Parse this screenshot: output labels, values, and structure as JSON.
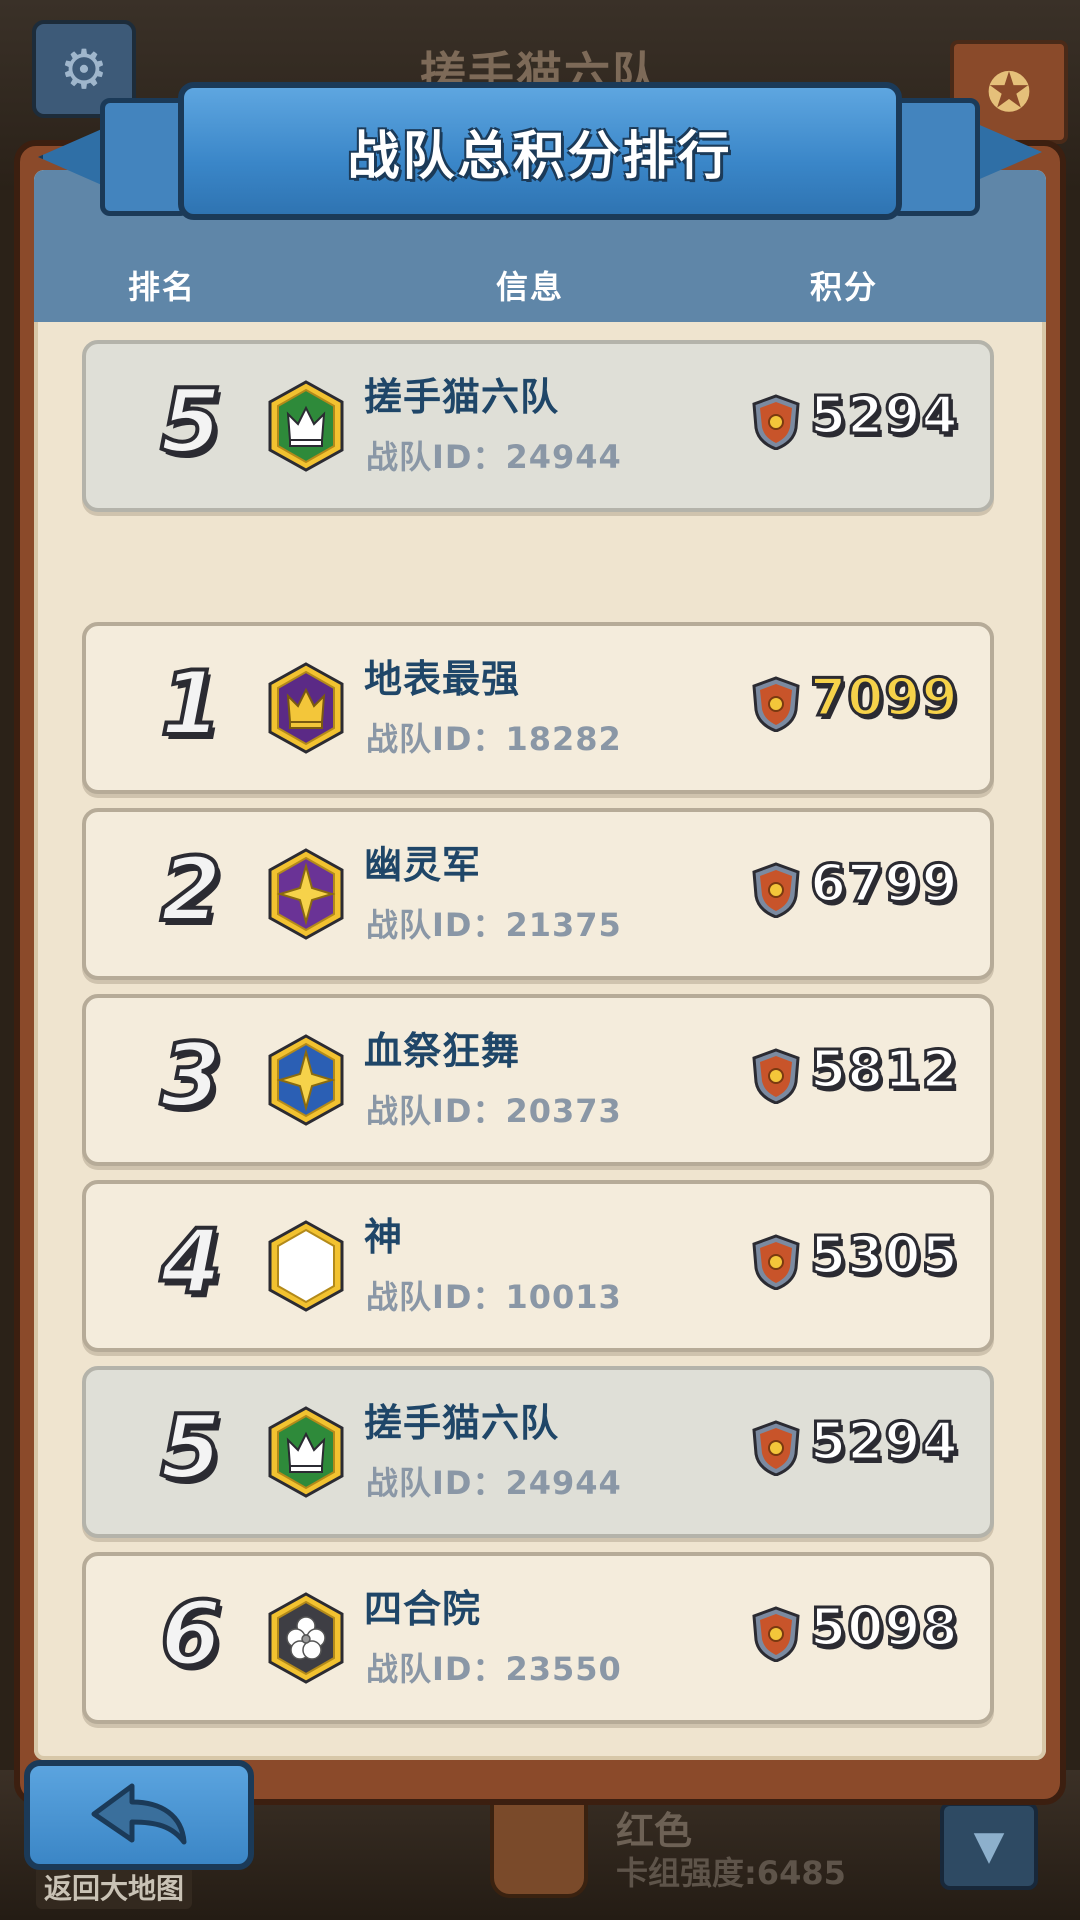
{
  "background": {
    "title": "搓手猫六队",
    "player_name": "红色",
    "deck_strength": "卡组强度:6485",
    "return_label": "返回大地图"
  },
  "panel": {
    "title": "战队总积分排行",
    "columns": {
      "rank": "排名",
      "info": "信息",
      "score": "积分"
    }
  },
  "my_team": {
    "rank": "5",
    "name": "搓手猫六队",
    "id": "战队ID：24944",
    "score": "5294",
    "emblem": "crown-green"
  },
  "rows": [
    {
      "rank": "1",
      "name": "地表最强",
      "id": "战队ID：18282",
      "score": "7099",
      "emblem": "crown-purple"
    },
    {
      "rank": "2",
      "name": "幽灵军",
      "id": "战队ID：21375",
      "score": "6799",
      "emblem": "star-purple"
    },
    {
      "rank": "3",
      "name": "血祭狂舞",
      "id": "战队ID：20373",
      "score": "5812",
      "emblem": "star-blue"
    },
    {
      "rank": "4",
      "name": "神",
      "id": "战队ID：10013",
      "score": "5305",
      "emblem": "blank-white"
    },
    {
      "rank": "5",
      "name": "搓手猫六队",
      "id": "战队ID：24944",
      "score": "5294",
      "emblem": "crown-green"
    },
    {
      "rank": "6",
      "name": "四合院",
      "id": "战队ID：23550",
      "score": "5098",
      "emblem": "flower-gray"
    }
  ],
  "colors": {
    "ribbon": "#3a86c8",
    "header_band": "#5f86a8",
    "team_name": "#1f4668",
    "first_place_score": "#f6d24a"
  }
}
